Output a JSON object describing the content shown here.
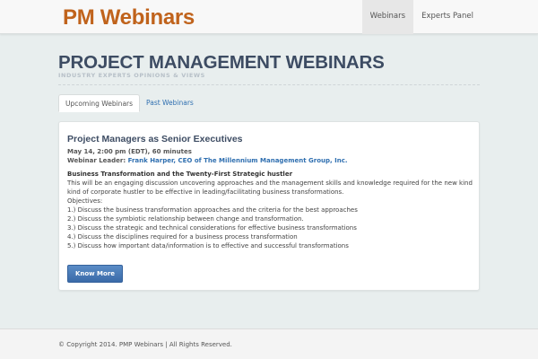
{
  "header": {
    "brand": "PM Webinars",
    "nav": [
      {
        "label": "Webinars",
        "active": true
      },
      {
        "label": "Experts Panel",
        "active": false
      }
    ]
  },
  "page": {
    "title": "PROJECT MANAGEMENT WEBINARS",
    "subtitle": "INDUSTRY EXPERTS OPINIONS & VIEWS"
  },
  "tabs": [
    {
      "label": "Upcoming Webinars",
      "active": true
    },
    {
      "label": "Past Webinars",
      "active": false
    }
  ],
  "webinar": {
    "title": "Project Managers as Senior Executives",
    "date": "May 14, 2:00 pm (EDT), 60 minutes",
    "leader_label": "Webinar Leader: ",
    "leader_name": "Frank Harper, CEO of The Millennium Management Group, Inc.",
    "subtitle": "Business Transformation and the Twenty-First Strategic hustler",
    "description": "This will be an engaging discussion uncovering approaches and the management skills and knowledge required for the new kind kind of corporate hustler to be effective in leading/facilitating business transformations.",
    "objectives_label": "Objectives:",
    "objectives": [
      "1.) Discuss the business transformation approaches and the criteria for the best approaches",
      "2.) Discuss the symbiotic relationship between change and transformation.",
      "3.) Discuss the strategic and technical considerations for effective business transformations",
      "4.) Discuss the disciplines required for a business process transformation",
      "5.) Discuss how important data/information is to effective and successful transformations"
    ],
    "button_label": "Know More"
  },
  "footer": {
    "text": "© Copyright 2014. PMP Webinars | All Rights Reserved."
  },
  "colors": {
    "brand": "#c0631c",
    "title": "#3d4c63",
    "link": "#2f6fb0",
    "button": "#3a6aa8",
    "background": "#e8eeee"
  }
}
